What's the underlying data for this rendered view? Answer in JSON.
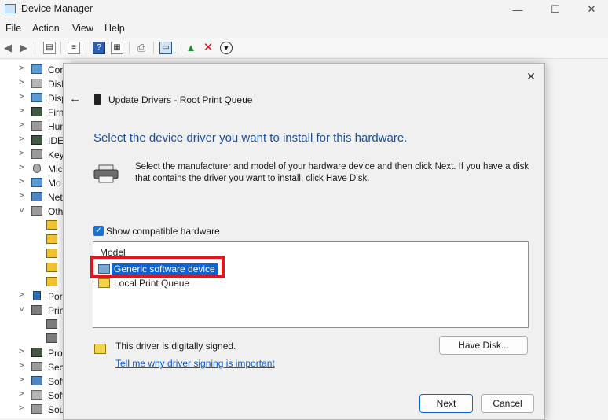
{
  "window": {
    "title": "Device Manager",
    "controls": {
      "minimize": "—",
      "maximize": "☐",
      "close": "✕"
    }
  },
  "menu": [
    "File",
    "Action",
    "View",
    "Help"
  ],
  "tree": {
    "items": [
      {
        "label": "Cor",
        "icon": "monitor-icon",
        "expanded": false
      },
      {
        "label": "Disk",
        "icon": "disk-drive-icon",
        "expanded": false
      },
      {
        "label": "Disp",
        "icon": "display-adapter-icon",
        "expanded": false
      },
      {
        "label": "Firm",
        "icon": "firmware-icon",
        "expanded": false
      },
      {
        "label": "Hum",
        "icon": "keyboard-icon",
        "expanded": false
      },
      {
        "label": "IDE",
        "icon": "chip-icon",
        "expanded": false
      },
      {
        "label": "Key",
        "icon": "keyboard-icon",
        "expanded": false
      },
      {
        "label": "Mic",
        "icon": "mouse-icon",
        "expanded": false
      },
      {
        "label": "Mo",
        "icon": "monitor-icon",
        "expanded": false
      },
      {
        "label": "Net",
        "icon": "network-icon",
        "expanded": false
      },
      {
        "label": "Oth",
        "icon": "other-devices-icon",
        "expanded": true
      },
      {
        "label": "",
        "icon": "warning-device-icon",
        "expanded": null
      },
      {
        "label": "",
        "icon": "warning-device-icon",
        "expanded": null
      },
      {
        "label": "",
        "icon": "warning-device-icon",
        "expanded": null
      },
      {
        "label": "",
        "icon": "warning-device-icon",
        "expanded": null
      },
      {
        "label": "",
        "icon": "warning-device-icon",
        "expanded": null
      },
      {
        "label": "Por",
        "icon": "port-icon",
        "expanded": false
      },
      {
        "label": "Prin",
        "icon": "printer-icon",
        "expanded": true
      },
      {
        "label": "",
        "icon": "printer-icon",
        "expanded": null
      },
      {
        "label": "",
        "icon": "printer-icon",
        "expanded": null
      },
      {
        "label": "Pro",
        "icon": "processor-icon",
        "expanded": false
      },
      {
        "label": "Sec",
        "icon": "security-icon",
        "expanded": false
      },
      {
        "label": "Soft",
        "icon": "software-component-icon",
        "expanded": false
      },
      {
        "label": "Soft",
        "icon": "software-device-icon",
        "expanded": false
      },
      {
        "label": "Sou",
        "icon": "sound-icon",
        "expanded": false
      }
    ]
  },
  "dialog": {
    "title": "Update Drivers - Root Print Queue",
    "heading": "Select the device driver you want to install for this hardware.",
    "description": "Select the manufacturer and model of your hardware device and then click Next. If you have a disk that contains the driver you want to install, click Have Disk.",
    "show_compatible_label": "Show compatible hardware",
    "show_compatible_checked": true,
    "list_header": "Model",
    "models": [
      {
        "label": "Generic software device",
        "selected": true
      },
      {
        "label": "Local Print Queue",
        "selected": false
      }
    ],
    "signed_text": "This driver is digitally signed.",
    "signing_link": "Tell me why driver signing is important",
    "have_disk_label": "Have Disk...",
    "next_label": "Next",
    "cancel_label": "Cancel",
    "close_glyph": "✕",
    "back_glyph": "←"
  },
  "colors": {
    "accent": "#0a64d6",
    "heading": "#1b4f9c",
    "highlight_box": "#e3141c",
    "link": "#0a58ca"
  }
}
